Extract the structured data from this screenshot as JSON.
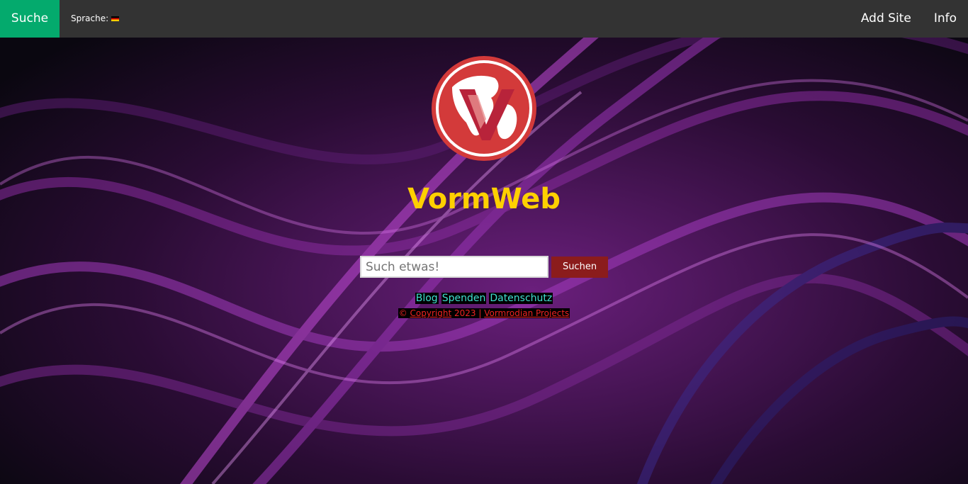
{
  "navbar": {
    "home_label": "Suche",
    "language_label": "Sprache:",
    "language_flag": "flag-de-icon",
    "right_links": [
      "Add Site",
      "Info"
    ]
  },
  "main": {
    "logo": "globe-v-logo",
    "title": "VormWeb",
    "search": {
      "placeholder": "Such etwas!",
      "value": "",
      "button_label": "Suchen"
    }
  },
  "footer": {
    "links": [
      "Blog",
      "Spenden",
      "Datenschutz"
    ],
    "copyright_symbol": "©",
    "copyright_link": "Copyright",
    "year_text": "2023 |",
    "projects_link": "Vormrodian Projects"
  },
  "colors": {
    "navbar_bg": "#333333",
    "home_bg": "#04aa6d",
    "title": "#ffd000",
    "search_button": "#8b1c1c",
    "footer_link": "#40e0d0",
    "copyright": "#ee2222"
  }
}
